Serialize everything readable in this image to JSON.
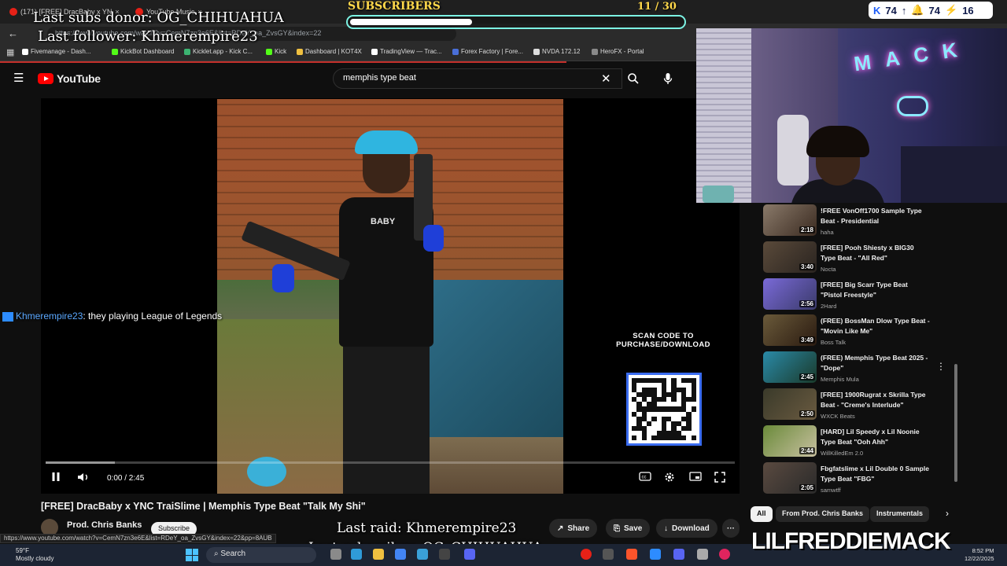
{
  "browser": {
    "tabs": [
      {
        "label": "(171) [FREE] DracBaby x YN",
        "close": "×"
      },
      {
        "label": "YouTube Music",
        "close": "×"
      }
    ],
    "url": "https://www.youtube.com/watch?v=CemN7zn3e6E&list=RDeY_oa_ZvsGY&index=22",
    "bookmarks": [
      "Fivemanage - Dash...",
      "KickBot Dashboard",
      "Kicklet.app - Kick C...",
      "Kick",
      "Dashboard | KOT4X",
      "TradingView — Trac...",
      "Forex Factory | Fore...",
      "NVDA 172.12",
      "HeroFX - Portal"
    ],
    "status_url": "https://www.youtube.com/watch?v=CemN7zn3e6E&list=RDeY_oa_ZvsGY&index=22&pp=8AUB"
  },
  "youtube": {
    "logo_text": "YouTube",
    "search_value": "memphis type beat",
    "player": {
      "time": "0:00 / 2:45",
      "progress_fraction": 0.0,
      "buffer_fraction": 0.1,
      "scan_text": "SCAN CODE TO PURCHASE/DOWNLOAD",
      "shirt_text": "BABY"
    },
    "video_title": "[FREE] DracBaby x YNC TraiSlime | Memphis Type Beat \"Talk My Shi\"",
    "channel": "Prod. Chris Banks",
    "subscribe_label": "Subscribe",
    "actions": {
      "share": "Share",
      "save": "Save",
      "download": "Download",
      "more": "···"
    },
    "recommendations": [
      {
        "title": "!FREE VonOff1700 Sample Type Beat - Presidential",
        "channel": "haha",
        "duration": "2:18"
      },
      {
        "title": "[FREE] Pooh Shiesty x BIG30 Type Beat - \"All Red\"",
        "channel": "Nocta",
        "duration": "3:40"
      },
      {
        "title": "[FREE] Big Scarr Type Beat \"Pistol Freestyle\"",
        "channel": "2Hard",
        "duration": "2:56"
      },
      {
        "title": "(FREE) BossMan Dlow Type Beat - \"Movin Like Me\"",
        "channel": "Boss Talk",
        "duration": "3:49"
      },
      {
        "title": "(FREE) Memphis Type Beat 2025 - \"Dope\"",
        "channel": "Memphis Mula",
        "duration": "2:45"
      },
      {
        "title": "[FREE] 1900Rugrat x Skrilla Type Beat - \"Creme's Interlude\"",
        "channel": "WXCK Beats",
        "duration": "2:50"
      },
      {
        "title": "[HARD] Lil Speedy x Lil Noonie Type Beat \"Ooh Ahh\"",
        "channel": "WillKilledEm 2.0",
        "duration": "2:44"
      },
      {
        "title": "Fbgfatslime x Lil Double 0 Sample Type Beat \"FBG\"",
        "channel": "samwtff",
        "duration": "2:05"
      }
    ],
    "chips": [
      "All",
      "From Prod. Chris Banks",
      "Instrumentals"
    ]
  },
  "overlay": {
    "donor": "Last subs donor: OG_CHIHUAHUA",
    "follower": "Last follower: Khmerempire23",
    "subs_label": "SUBSCRIBERS",
    "subs_count": "11 / 30",
    "subs_fraction": 0.367,
    "stat_kick": "74",
    "stat_bell": "74",
    "stat_sub": "16",
    "chat_user": "Khmerempire23",
    "chat_message": ": they playing League of Legends",
    "raid": "Last raid: Khmerempire23",
    "last_sub": "Last subscriber: OG_CHIHUAHUA",
    "brand": "LILFREDDIEMACK",
    "neon_sign": "MACK"
  },
  "taskbar": {
    "temp": "59°F",
    "weather": "Mostly cloudy",
    "search": "Search",
    "time": "8:52 PM",
    "date": "12/22/2025"
  },
  "colors": {
    "yt_red": "#ff0000",
    "subs_gold": "#ffd84a",
    "subs_bar_border": "#7cf3e4",
    "chat_user": "#5ba8ff"
  }
}
